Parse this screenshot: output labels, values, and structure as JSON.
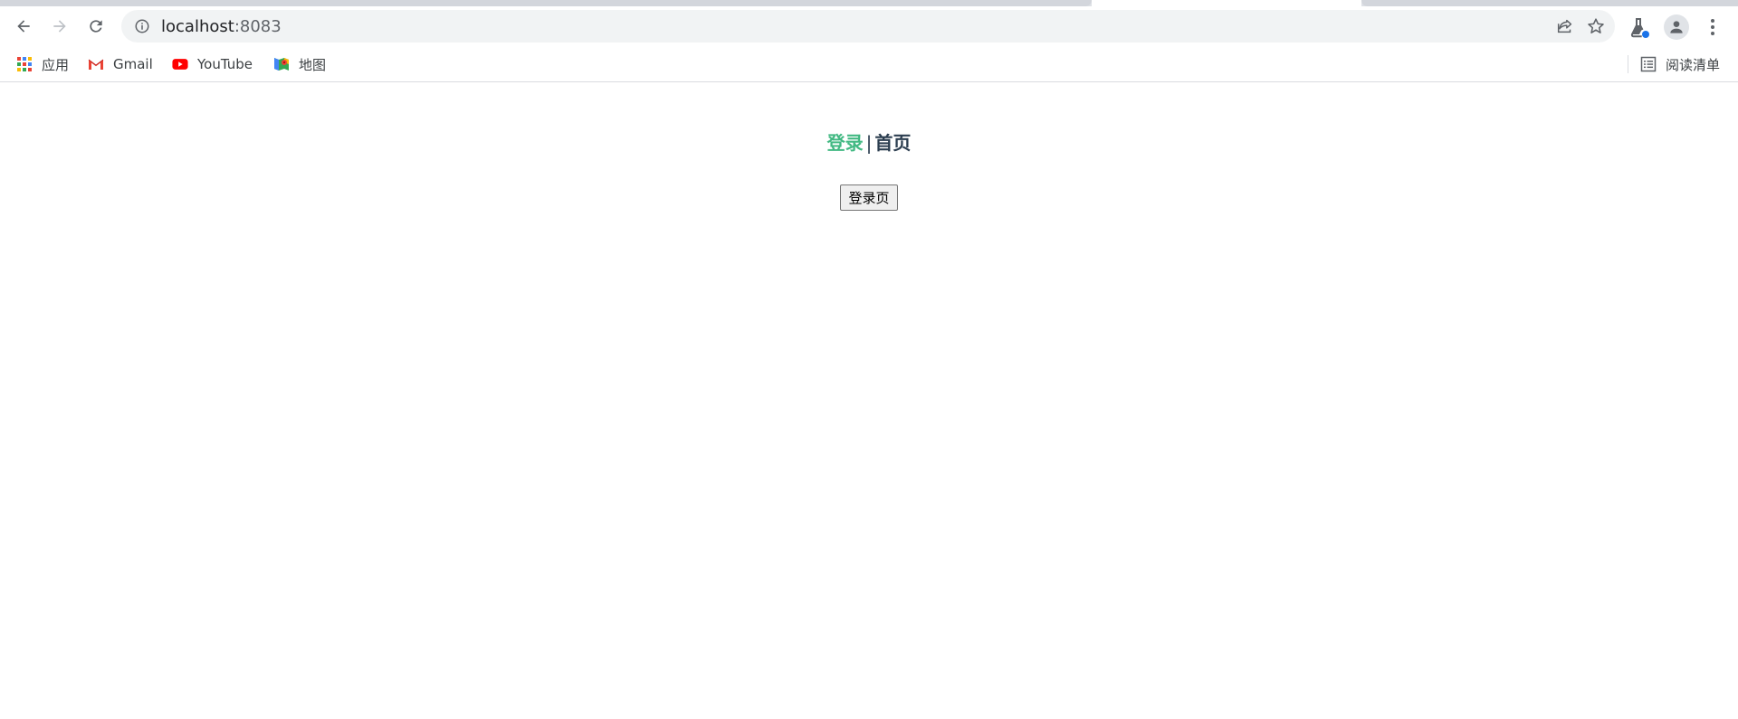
{
  "browser": {
    "url_host": "localhost",
    "url_port": ":8083",
    "bookmarks": [
      {
        "label": "应用",
        "icon": "apps-grid-icon"
      },
      {
        "label": "Gmail",
        "icon": "gmail-icon"
      },
      {
        "label": "YouTube",
        "icon": "youtube-icon"
      },
      {
        "label": "地图",
        "icon": "maps-icon"
      }
    ],
    "reading_list_label": "阅读清单"
  },
  "page": {
    "nav": {
      "login_link": "登录",
      "separator": "|",
      "home_link": "首页"
    },
    "login_button_label": "登录页"
  },
  "colors": {
    "active_link": "#42b983",
    "text": "#2c3e50"
  }
}
